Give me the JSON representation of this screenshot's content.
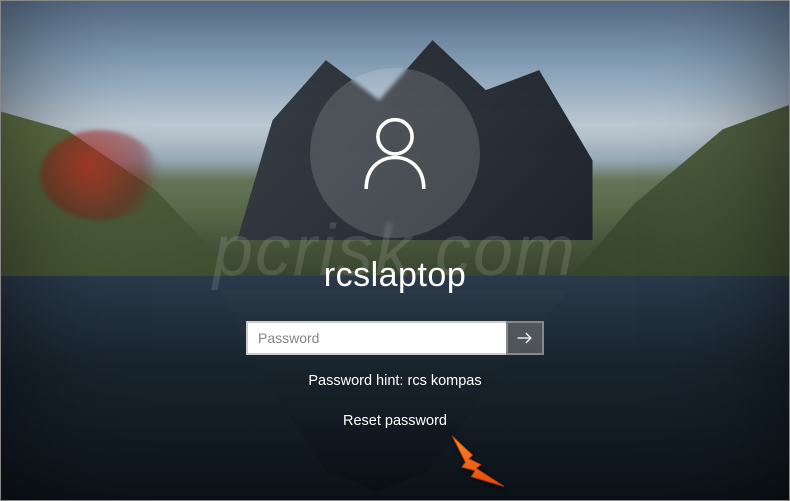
{
  "user": {
    "name": "rcslaptop"
  },
  "password": {
    "placeholder": "Password",
    "value": ""
  },
  "hint": {
    "label": "Password hint: rcs kompas"
  },
  "reset": {
    "label": "Reset password"
  },
  "watermark": {
    "text": "pcrisk.com"
  },
  "icons": {
    "avatar": "user-icon",
    "submit": "arrow-right-icon",
    "annotation": "orange-arrow-icon"
  },
  "colors": {
    "accent_arrow": "#ff6a1a",
    "text": "#ffffff",
    "input_bg": "#ffffff",
    "submit_bg": "rgba(120,120,120,0.55)"
  }
}
